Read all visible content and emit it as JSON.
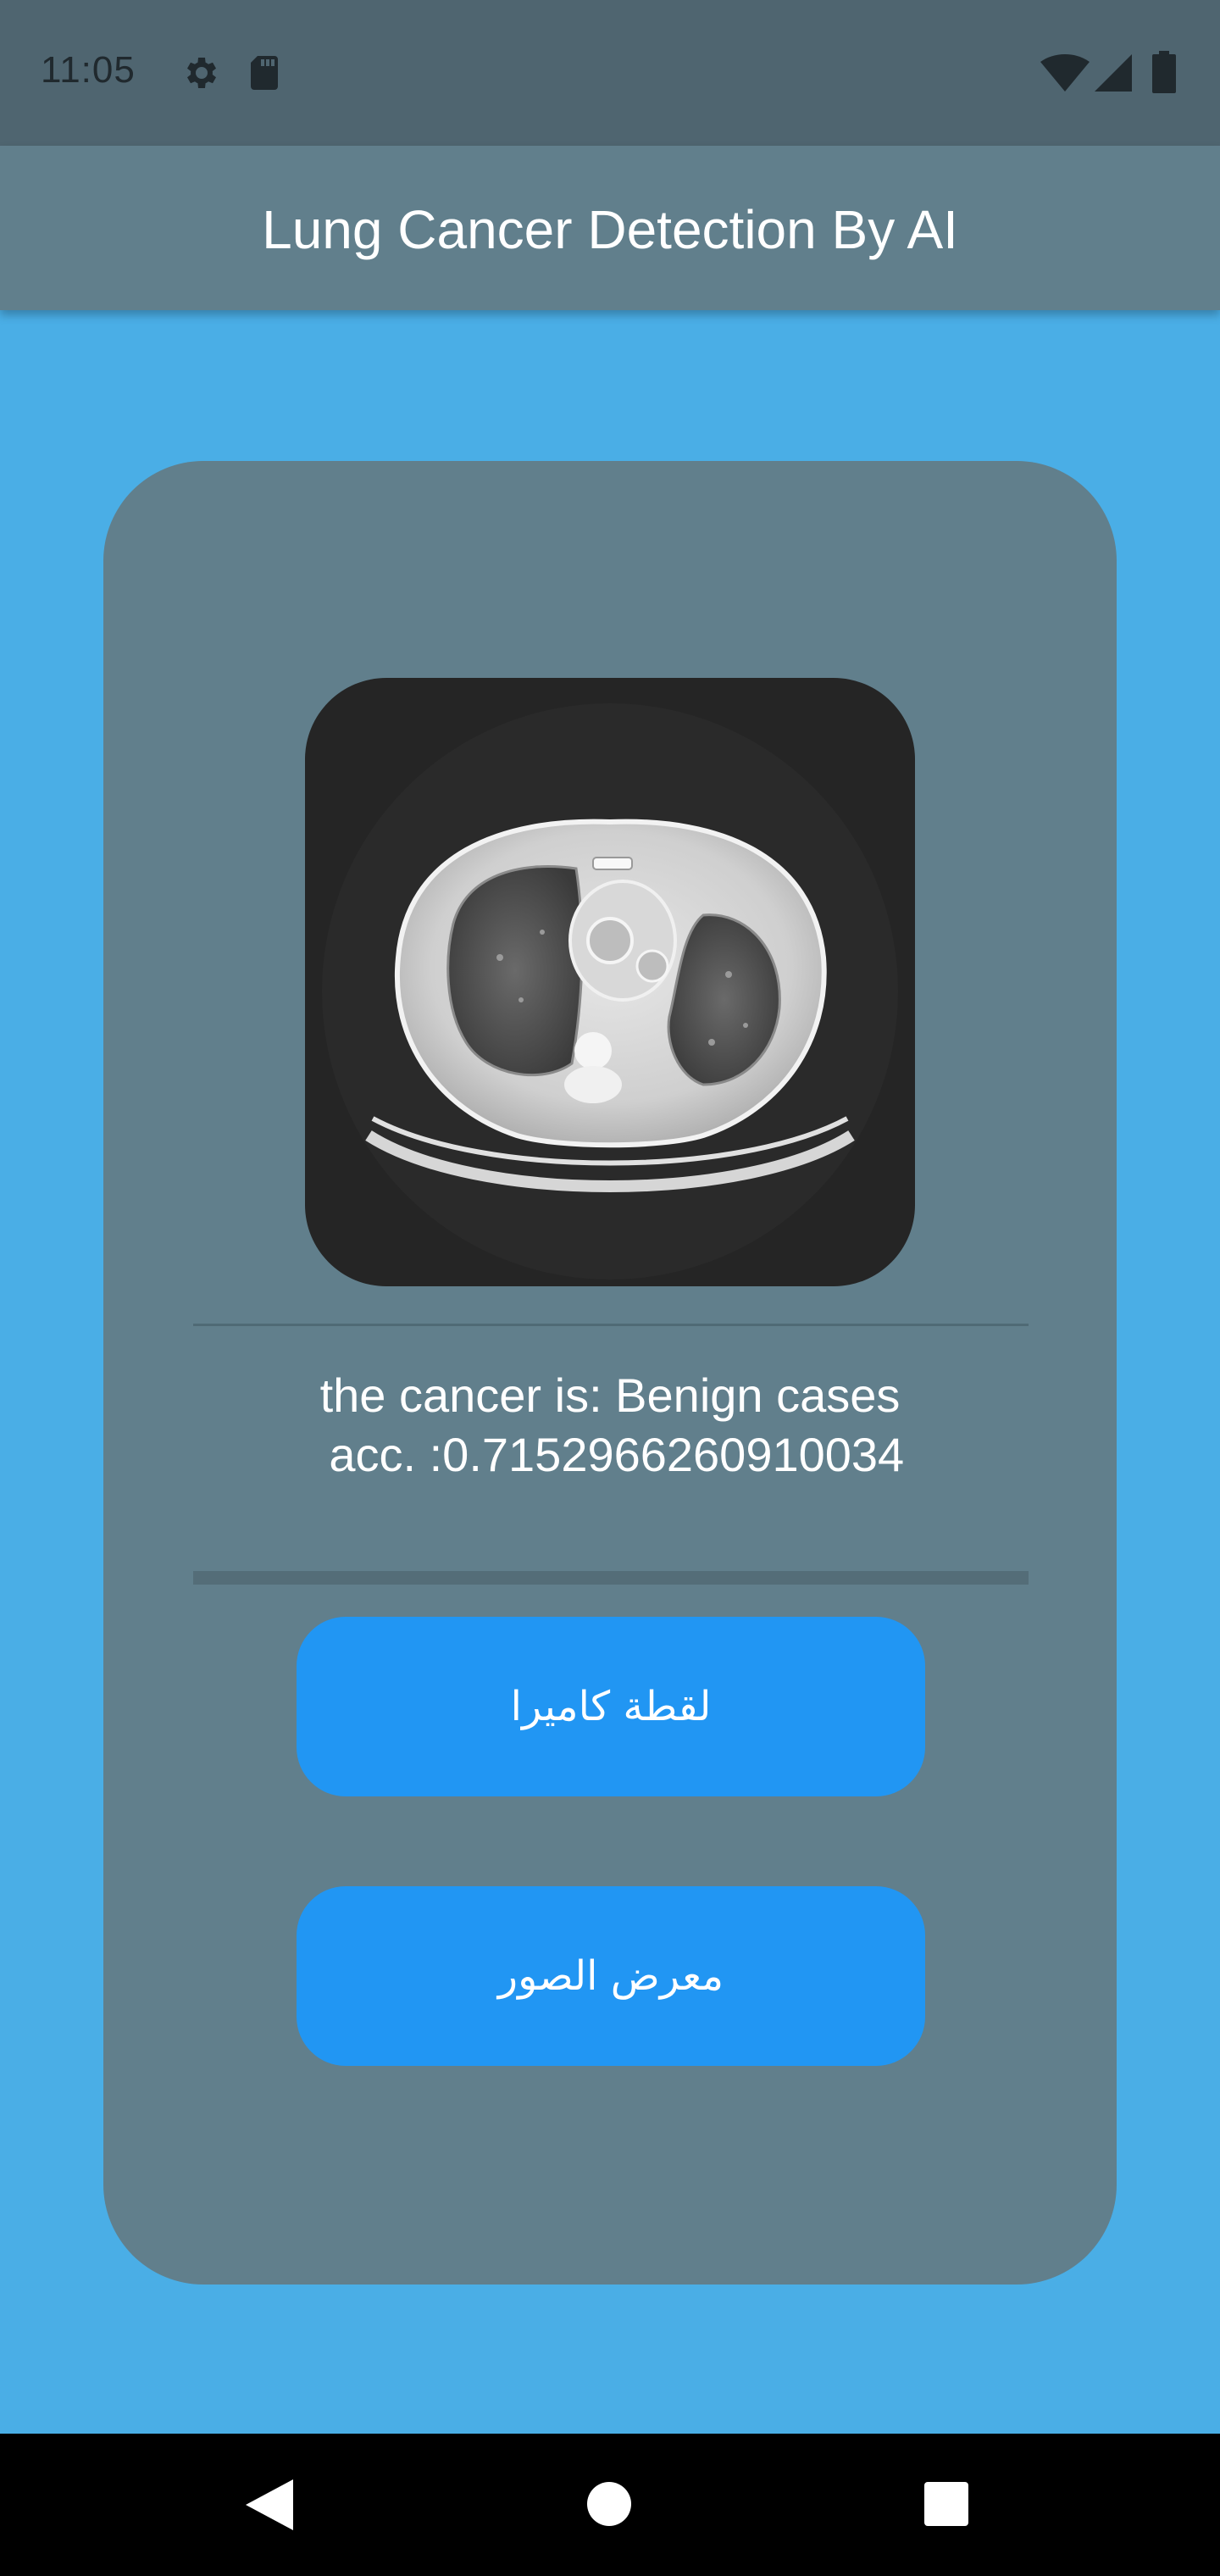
{
  "status_bar": {
    "time": "11:05",
    "left_icons": [
      "gear-icon",
      "sd-card-icon"
    ],
    "right_icons": [
      "wifi-icon",
      "signal-icon",
      "battery-icon"
    ]
  },
  "app_bar": {
    "title": "Lung Cancer Detection By AI"
  },
  "card": {
    "image_icon": "ct-scan-image",
    "result_text": "the cancer is: Benign cases\n acc. :0.7152966260910034",
    "buttons": {
      "camera_label": "لقطة كاميرا",
      "gallery_label": "معرض الصور"
    }
  },
  "nav_bar": {
    "icons": [
      "back-icon",
      "home-icon",
      "recents-icon"
    ]
  },
  "colors": {
    "background": "#4AAEE6",
    "status_bar": "#4F6570",
    "app_bar": "#617F8C",
    "card": "#617F8C",
    "button": "#2196F3"
  }
}
